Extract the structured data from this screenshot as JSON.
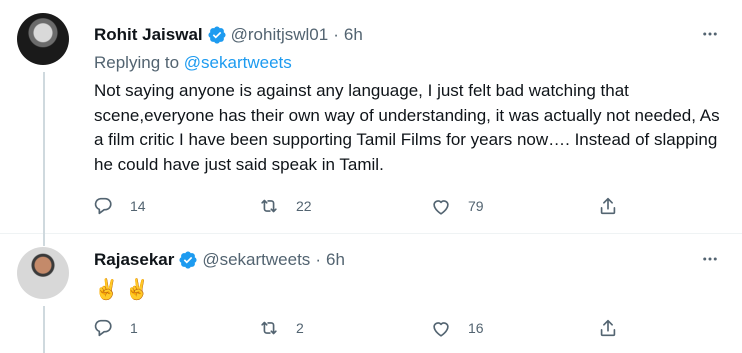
{
  "tweets": [
    {
      "name": "Rohit Jaiswal",
      "handle": "@rohitjswl01",
      "separator": "·",
      "time": "6h",
      "replying_prefix": "Replying to",
      "replying_to": "@sekartweets",
      "text": "Not saying anyone is against any language, I just felt bad watching that scene,everyone has their own way of understanding, it was actually not needed, As a film critic I have been supporting Tamil Films for years now…. Instead of slapping he could have just said speak in Tamil.",
      "replies": "14",
      "retweets": "22",
      "likes": "79"
    },
    {
      "name": "Rajasekar",
      "handle": "@sekartweets",
      "separator": "·",
      "time": "6h",
      "text": "✌ ✌",
      "replies": "1",
      "retweets": "2",
      "likes": "16"
    }
  ],
  "icons": {
    "verified": "verified-badge-icon",
    "more": "more-options-icon",
    "reply": "reply-icon",
    "retweet": "retweet-icon",
    "like": "like-icon",
    "share": "share-icon"
  },
  "colors": {
    "link": "#1d9bf0",
    "secondary_text": "#536471",
    "primary_text": "#0f1419",
    "divider": "#eff3f4"
  }
}
